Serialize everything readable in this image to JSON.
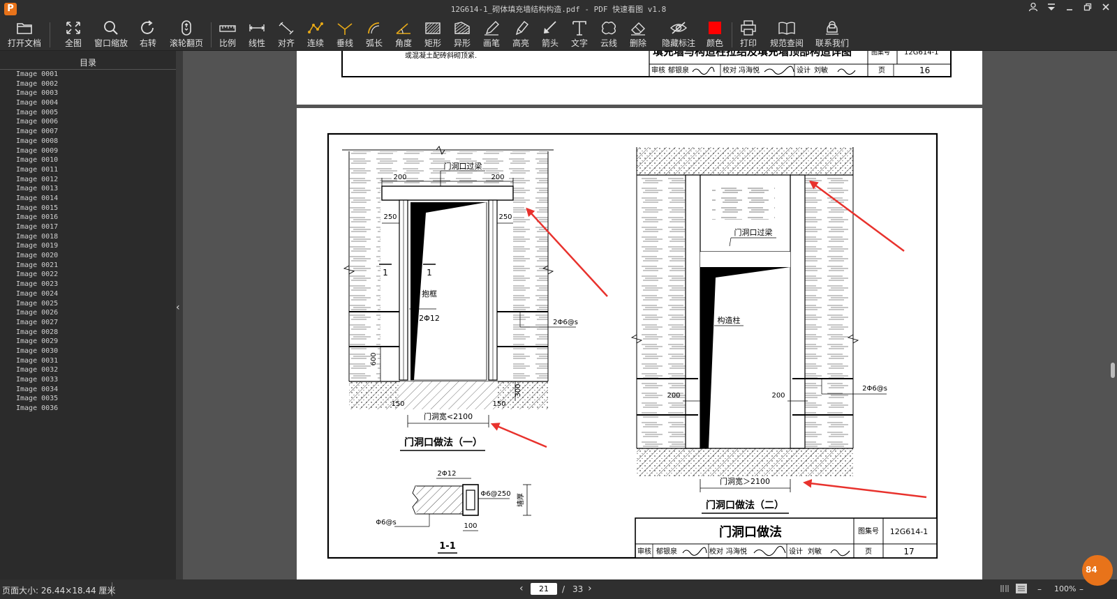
{
  "window": {
    "title": "12G614-1_砌体填充墙结构构造.pdf - PDF 快速看图 v1.8",
    "logo_letter": "P"
  },
  "toolbar": [
    {
      "name": "open-file",
      "label": "打开文档",
      "icon": "folder-icon"
    },
    {
      "name": "fit-page",
      "label": "全图",
      "icon": "expand-icon"
    },
    {
      "name": "window-zoom",
      "label": "窗口缩放",
      "icon": "search-icon"
    },
    {
      "name": "rotate-right",
      "label": "右转",
      "icon": "rotate-icon"
    },
    {
      "name": "scroll-page",
      "label": "滚轮翻页",
      "icon": "mouse-icon"
    },
    {
      "name": "scale",
      "label": "比例",
      "icon": "ruler-icon"
    },
    {
      "name": "linear",
      "label": "线性",
      "icon": "linear-icon"
    },
    {
      "name": "aligned",
      "label": "对齐",
      "icon": "aligned-icon"
    },
    {
      "name": "continuous",
      "label": "连续",
      "icon": "continuous-icon"
    },
    {
      "name": "perpendicular",
      "label": "垂线",
      "icon": "perpendicular-icon"
    },
    {
      "name": "arc-length",
      "label": "弧长",
      "icon": "arc-icon"
    },
    {
      "name": "angle",
      "label": "角度",
      "icon": "angle-icon"
    },
    {
      "name": "rectangle",
      "label": "矩形",
      "icon": "rectangle-icon"
    },
    {
      "name": "irregular",
      "label": "异形",
      "icon": "irregular-icon"
    },
    {
      "name": "pen",
      "label": "画笔",
      "icon": "pen-icon"
    },
    {
      "name": "highlight",
      "label": "高亮",
      "icon": "highlighter-icon"
    },
    {
      "name": "arrow",
      "label": "箭头",
      "icon": "arrow-icon"
    },
    {
      "name": "text",
      "label": "文字",
      "icon": "text-icon"
    },
    {
      "name": "cloud",
      "label": "云线",
      "icon": "cloud-icon"
    },
    {
      "name": "delete",
      "label": "删除",
      "icon": "eraser-icon"
    },
    {
      "name": "hide-marks",
      "label": "隐藏标注",
      "icon": "eye-off-icon"
    },
    {
      "name": "color",
      "label": "颜色",
      "icon": "color-swatch-icon",
      "color": "#ff0000"
    },
    {
      "name": "print",
      "label": "打印",
      "icon": "printer-icon"
    },
    {
      "name": "spec-lookup",
      "label": "规范查阅",
      "icon": "book-icon"
    },
    {
      "name": "contact",
      "label": "联系我们",
      "icon": "support-icon"
    }
  ],
  "sidebar": {
    "header": "目录",
    "items": [
      "Image 0001",
      "Image 0002",
      "Image 0003",
      "Image 0004",
      "Image 0005",
      "Image 0006",
      "Image 0007",
      "Image 0008",
      "Image 0009",
      "Image 0010",
      "Image 0011",
      "Image 0012",
      "Image 0013",
      "Image 0014",
      "Image 0015",
      "Image 0016",
      "Image 0017",
      "Image 0018",
      "Image 0019",
      "Image 0020",
      "Image 0021",
      "Image 0022",
      "Image 0023",
      "Image 0024",
      "Image 0025",
      "Image 0026",
      "Image 0027",
      "Image 0028",
      "Image 0029",
      "Image 0030",
      "Image 0031",
      "Image 0032",
      "Image 0033",
      "Image 0034",
      "Image 0035",
      "Image 0036"
    ]
  },
  "prev_page": {
    "note": "或混凝土配砖斜砌顶紧.",
    "title": "填充墙与构造柱拉结及填充墙顶部构造详图",
    "atlas_label": "图集号",
    "atlas_no": "12G614-1",
    "review_label": "审核",
    "reviewer": "郁银泉",
    "check_label": "校对",
    "checker": "冯海悦",
    "design_label": "设计",
    "designer": "刘敏",
    "page_label": "页",
    "page_no": "16"
  },
  "drawing": {
    "left": {
      "lintel_label": "门洞口过梁",
      "dim_200_left": "200",
      "dim_200_right": "200",
      "dim_250_left": "250",
      "dim_250_right": "250",
      "section_mark": "1",
      "frame_label": "抱框",
      "rebar_label": "2Φ12",
      "tie_label": "2Φ6@s",
      "dim_600": "600",
      "dim_300": "300",
      "dim_150_left": "150",
      "dim_150_right": "150",
      "width_label": "门洞宽<2100",
      "caption": "门洞口做法（一）"
    },
    "section": {
      "rebar_label": "2Φ12",
      "stirrup_label": "Φ6@250",
      "tie_label": "Φ6@s",
      "wall_label": "墙厚",
      "dim_100": "100",
      "caption": "1-1"
    },
    "right": {
      "lintel_label": "门洞口过梁",
      "column_label": "构造柱",
      "dim_200_left": "200",
      "dim_200_right": "200",
      "tie_label": "2Φ6@s",
      "width_label": "门洞宽＞2100",
      "caption": "门洞口做法（二）"
    },
    "titleblock": {
      "title": "门洞口做法",
      "atlas_label": "图集号",
      "atlas_no": "12G614-1",
      "review_label": "审核",
      "reviewer": "郁银泉",
      "check_label": "校对",
      "checker": "冯海悦",
      "design_label": "设计",
      "designer": "刘敏",
      "page_label": "页",
      "page_no": "17"
    }
  },
  "status": {
    "page_size": "页面大小: 26.44×18.44 厘米",
    "current_page": "21",
    "separator": "/",
    "total_pages": "33",
    "zoom": "100%",
    "badge": "84"
  },
  "colors": {
    "annotation_arrow": "#e8322d",
    "color_swatch": "#ff0000",
    "logo": "#e8731a",
    "badge": "#e8731a"
  }
}
